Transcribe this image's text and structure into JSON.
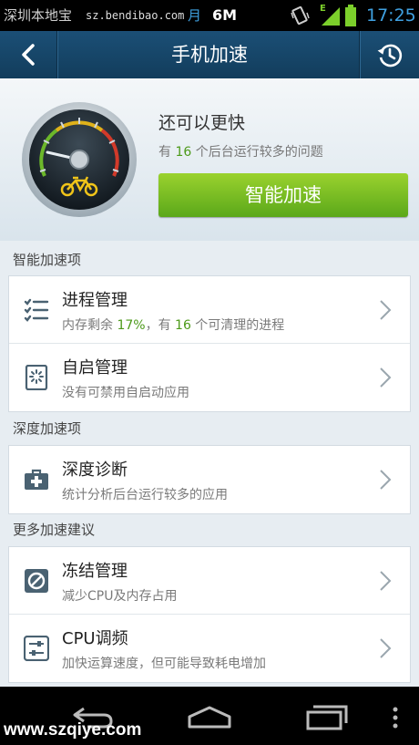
{
  "status_bar": {
    "app_name": "深圳本地宝",
    "url": "sz.bendibao.com",
    "month_glyph": "月",
    "data_size": "6M",
    "network": "E",
    "time": "17:25"
  },
  "header": {
    "title": "手机加速",
    "back_icon": "back-arrow-icon",
    "history_icon": "clock-history-icon"
  },
  "hero": {
    "title": "还可以更快",
    "sub_prefix": "有 ",
    "sub_count": "16",
    "sub_suffix": " 个后台运行较多的问题",
    "button": "智能加速"
  },
  "sections": [
    {
      "header": "智能加速项",
      "items": [
        {
          "icon": "checklist-icon",
          "title": "进程管理",
          "sub_a": "内存剩余 ",
          "sub_b": "17%",
          "sub_c": "，有 ",
          "sub_d": "16",
          "sub_e": " 个可清理的进程"
        },
        {
          "icon": "autostart-icon",
          "title": "自启管理",
          "sub": "没有可禁用自启动应用"
        }
      ]
    },
    {
      "header": "深度加速项",
      "items": [
        {
          "icon": "first-aid-kit-icon",
          "title": "深度诊断",
          "sub": "统计分析后台运行较多的应用"
        }
      ]
    },
    {
      "header": "更多加速建议",
      "items": [
        {
          "icon": "freeze-icon",
          "title": "冻结管理",
          "sub": "减少CPU及内存占用"
        },
        {
          "icon": "sliders-icon",
          "title": "CPU调频",
          "sub": "加快运算速度，但可能导致耗电增加"
        }
      ]
    }
  ],
  "watermark": "www.szqiye.com",
  "colors": {
    "accent_green": "#7cc224",
    "header_blue": "#1b4f76",
    "highlight_green": "#4d9a1a"
  }
}
